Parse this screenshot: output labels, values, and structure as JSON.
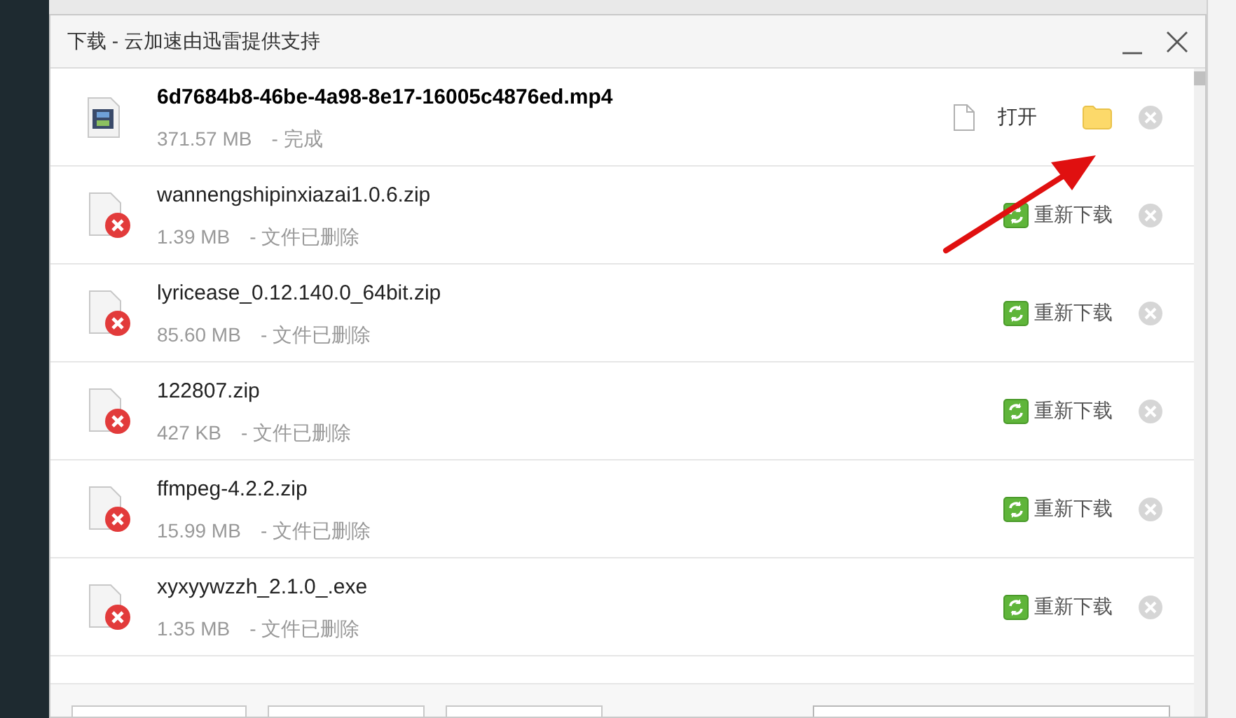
{
  "window": {
    "title": "下载 - 云加速由迅雷提供支持"
  },
  "downloads": [
    {
      "kind": "done",
      "name": "6d7684b8-46be-4a98-8e17-16005c4876ed.mp4",
      "size": "371.57 MB",
      "status": "- 完成",
      "action": "打开"
    },
    {
      "kind": "deleted",
      "name": "wannengshipinxiazai1.0.6.zip",
      "size": "1.39 MB",
      "status": "- 文件已删除",
      "action": "重新下载"
    },
    {
      "kind": "deleted",
      "name": "lyricease_0.12.140.0_64bit.zip",
      "size": "85.60 MB",
      "status": "- 文件已删除",
      "action": "重新下载"
    },
    {
      "kind": "deleted",
      "name": "122807.zip",
      "size": "427 KB",
      "status": "- 文件已删除",
      "action": "重新下载"
    },
    {
      "kind": "deleted",
      "name": "ffmpeg-4.2.2.zip",
      "size": "15.99 MB",
      "status": "- 文件已删除",
      "action": "重新下载"
    },
    {
      "kind": "deleted",
      "name": "xyxyywzzh_2.1.0_.exe",
      "size": "1.35 MB",
      "status": "- 文件已删除",
      "action": "重新下载"
    }
  ]
}
